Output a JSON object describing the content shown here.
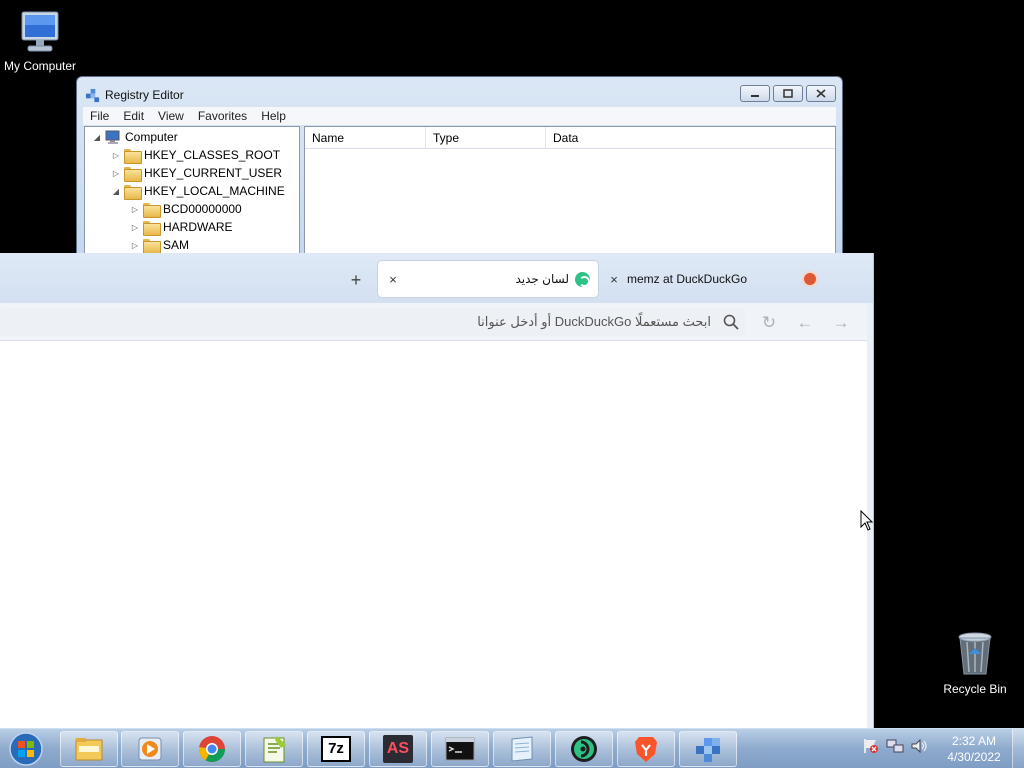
{
  "desktop": {
    "my_computer_label": "My Computer",
    "recycle_bin_label": "Recycle Bin"
  },
  "regedit": {
    "title": "Registry Editor",
    "menu": [
      "File",
      "Edit",
      "View",
      "Favorites",
      "Help"
    ],
    "tree": [
      {
        "label": "Computer",
        "expander": "◢",
        "type": "computer"
      },
      {
        "label": "HKEY_CLASSES_ROOT",
        "expander": "▷",
        "type": "folder"
      },
      {
        "label": "HKEY_CURRENT_USER",
        "expander": "▷",
        "type": "folder"
      },
      {
        "label": "HKEY_LOCAL_MACHINE",
        "expander": "◢",
        "type": "folder"
      },
      {
        "label": "BCD00000000",
        "expander": "▷",
        "type": "folder"
      },
      {
        "label": "HARDWARE",
        "expander": "▷",
        "type": "folder"
      },
      {
        "label": "SAM",
        "expander": "▷",
        "type": "folder"
      }
    ],
    "columns": [
      "Name",
      "Type",
      "Data"
    ]
  },
  "browser": {
    "active_tab_title": "لسان جديد",
    "inactive_tab_title": "memz at DuckDuckGo",
    "new_tab_symbol": "+",
    "close_symbol": "×",
    "address_placeholder": "ابحث مستعملًا DuckDuckGo أو أدخل عنوانا",
    "nav_back": "←",
    "nav_forward": "→",
    "nav_reload": "↻"
  },
  "taskbar": {
    "items": [
      "start-orb-icon",
      "file-explorer-icon",
      "media-player-icon",
      "chrome-icon",
      "notepad-plus-plus-icon",
      "7zip-icon",
      "android-studio-icon",
      "command-prompt-icon",
      "notepad-icon",
      "duckduckgo-browser-icon",
      "brave-icon",
      "registry-editor-icon"
    ],
    "sevenzip_label": "7z",
    "as_label": "AS",
    "time": "2:32 AM",
    "date": "4/30/2022"
  },
  "colors": {
    "desktop_bg": "#000000",
    "ddg_green": "#2ec184",
    "ddg_orange": "#de5833",
    "taskbar": "#8eaacd"
  }
}
